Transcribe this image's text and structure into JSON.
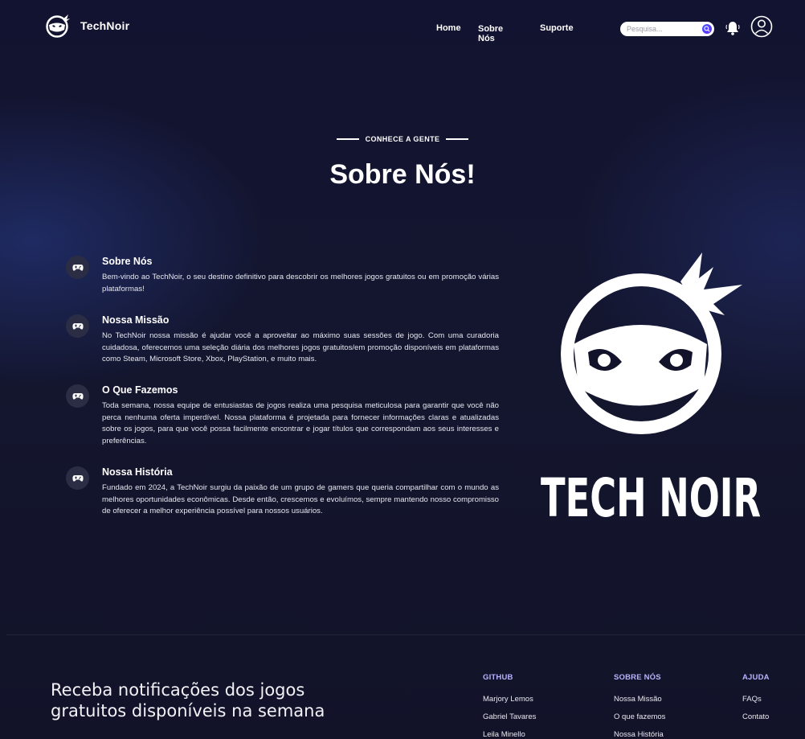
{
  "brand": {
    "name": "TechNoir",
    "logo_wordmark": "TECH NOIR"
  },
  "nav": {
    "home": "Home",
    "about": "Sobre Nós",
    "support": "Suporte"
  },
  "search": {
    "placeholder": "Pesquisa..."
  },
  "hero": {
    "eyebrow": "CONHECE A GENTE",
    "title": "Sobre Nós!"
  },
  "sections": [
    {
      "icon": "gamepad-icon",
      "title": "Sobre Nós",
      "body": "Bem-vindo ao TechNoir, o seu destino definitivo para descobrir os melhores jogos gratuitos ou em promoção várias plataformas!"
    },
    {
      "icon": "gamepad-icon",
      "title": "Nossa Missão",
      "body": "No TechNoir nossa missão é ajudar você a aproveitar ao máximo suas sessões de jogo. Com uma curadoria cuidadosa, oferecemos uma seleção diária dos melhores jogos gratuitos/em promoção disponíveis em plataformas como Steam, Microsoft Store, Xbox, PlayStation, e muito mais."
    },
    {
      "icon": "gamepad-icon",
      "title": "O Que Fazemos",
      "body": "Toda semana, nossa equipe de entusiastas de jogos realiza uma pesquisa meticulosa para garantir que você não perca nenhuma oferta imperdível. Nossa plataforma é projetada para fornecer informações claras e atualizadas sobre os jogos, para que você possa facilmente encontrar e jogar títulos que correspondam aos seus interesses e preferências."
    },
    {
      "icon": "gamepad-icon",
      "title": "Nossa História",
      "body": "Fundado em 2024, a TechNoir surgiu da paixão de um grupo de gamers que queria compartilhar com o mundo as melhores oportunidades econômicas. Desde então, crescemos e evoluímos, sempre mantendo nosso compromisso de oferecer a melhor experiência possível para nossos usuários."
    }
  ],
  "footer": {
    "cta": "Receba notificações dos jogos gratuitos disponíveis na semana",
    "columns": [
      {
        "title": "GITHUB",
        "links": [
          "Marjory Lemos",
          "Gabriel Tavares",
          "Leila Minello"
        ]
      },
      {
        "title": "SOBRE NÓS",
        "links": [
          "Nossa Missão",
          "O que fazemos",
          "Nossa História"
        ]
      },
      {
        "title": "AJUDA",
        "links": [
          "FAQs",
          "Contato"
        ]
      }
    ]
  },
  "colors": {
    "background": "#12132a",
    "accent": "#b9b3ff",
    "search_button": "#3d58ff"
  }
}
